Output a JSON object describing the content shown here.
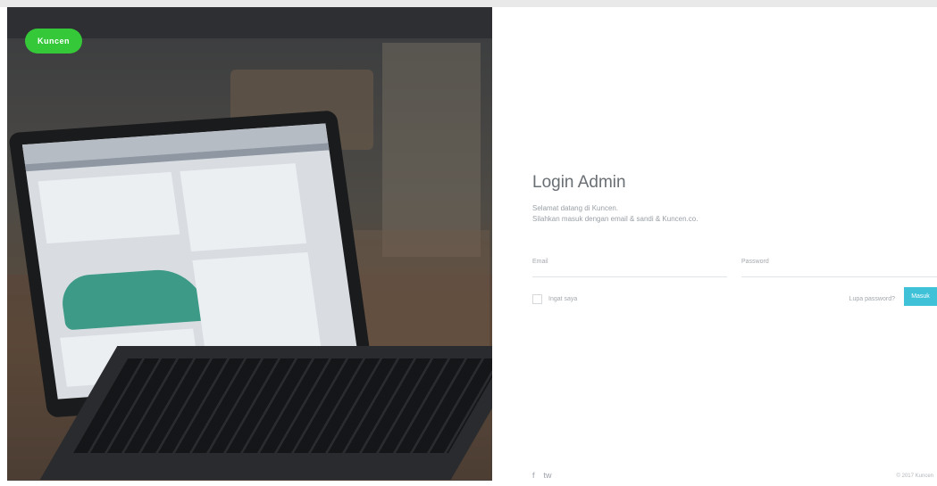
{
  "brand": {
    "logo_text": "Kuncen",
    "accent_color": "#35c93a"
  },
  "login": {
    "title": "Login Admin",
    "subtitle_line1": "Selamat datang di Kuncen.",
    "subtitle_line2": "Silahkan masuk dengan email & sandi & Kuncen.co.",
    "email_label": "Email",
    "password_label": "Password",
    "remember_label": "Ingat saya",
    "forgot_label": "Lupa password?",
    "login_button": "Masuk",
    "button_color": "#3fc1d8"
  },
  "footer": {
    "social_1": "f",
    "social_2": "tw",
    "copyright": "© 2017 Kuncen"
  }
}
